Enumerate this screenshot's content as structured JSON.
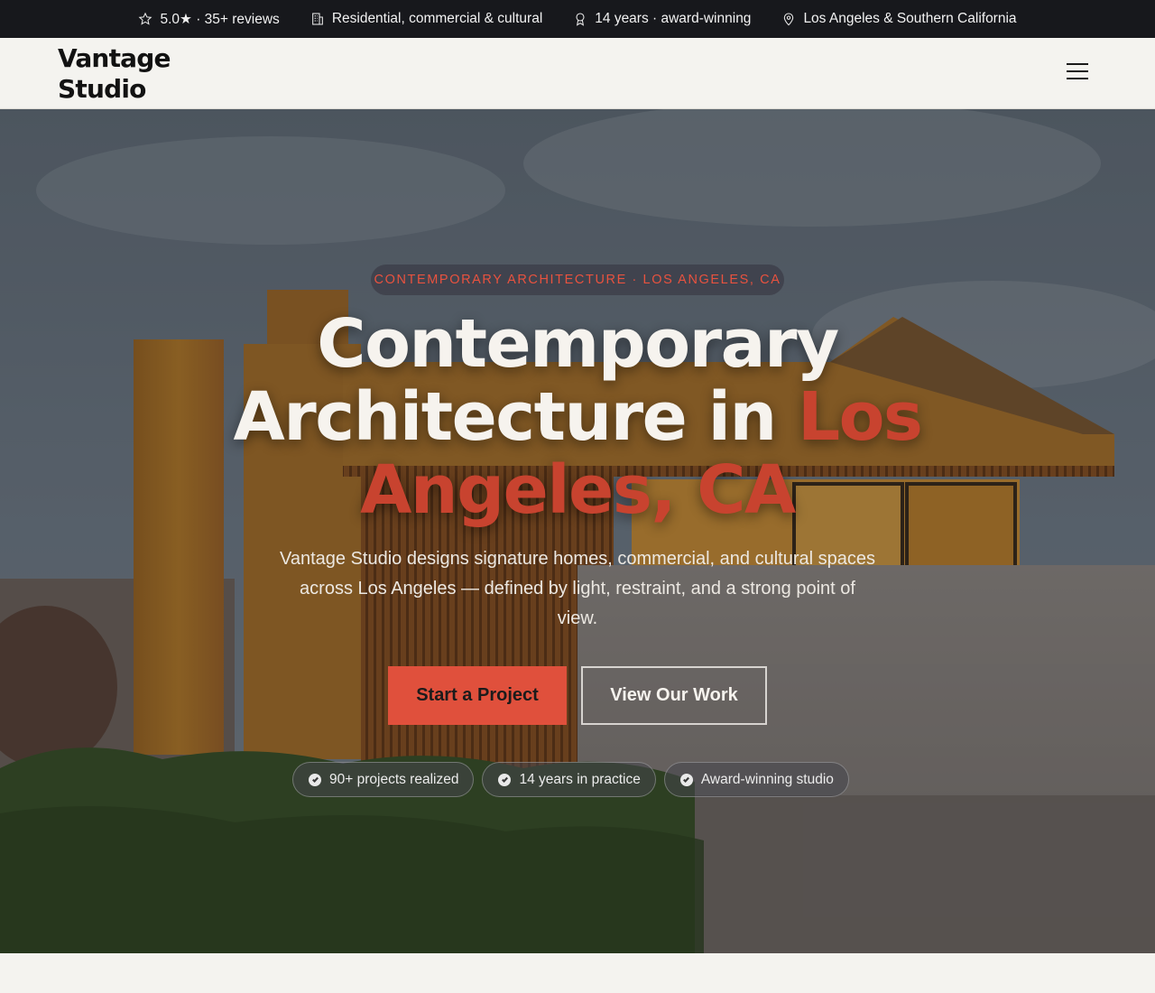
{
  "topbar": {
    "items": [
      {
        "icon": "star-icon",
        "text": "5.0★ · 35+ reviews"
      },
      {
        "icon": "building-icon",
        "text": "Residential, commercial & cultural"
      },
      {
        "icon": "award-icon",
        "text": "14 years · award-winning"
      },
      {
        "icon": "map-pin-icon",
        "text": "Los Angeles & Southern California"
      }
    ]
  },
  "header": {
    "logo_line1": "Vantage",
    "logo_line2": "Studio",
    "menu_icon": "hamburger-menu-icon"
  },
  "hero": {
    "eyebrow": "CONTEMPORARY ARCHITECTURE · LOS ANGELES, CA",
    "headline_line1": "Contemporary",
    "headline_line2_plain": "Architecture in ",
    "headline_line2_accent": "Los",
    "headline_line3_accent": "Angeles, CA",
    "subtext": "Vantage Studio designs signature homes, commercial, and cultural spaces across Los Angeles — defined by light, restraint, and a strong point of view.",
    "primary_cta": "Start a Project",
    "secondary_cta": "View Our Work",
    "badges": [
      {
        "icon": "check-circle-icon",
        "text": "90+ projects realized"
      },
      {
        "icon": "check-circle-icon",
        "text": "14 years in practice"
      },
      {
        "icon": "check-circle-icon",
        "text": "Award-winning studio"
      }
    ]
  },
  "colors": {
    "accent": "#e0503c",
    "headline_accent": "#c8432f",
    "topbar_bg": "#17181c",
    "page_bg": "#f4f3ef"
  }
}
